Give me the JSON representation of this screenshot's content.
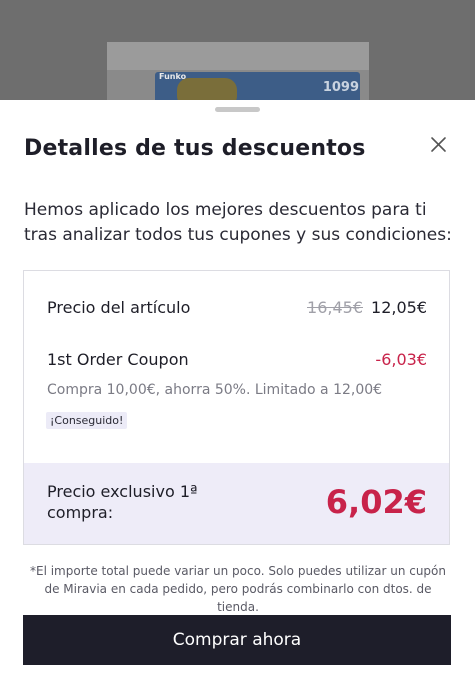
{
  "backdrop": {
    "product_number": "1099",
    "brand": "Funko"
  },
  "sheet": {
    "title": "Detalles de tus descuentos",
    "intro": "Hemos aplicado los mejores descuentos para ti tras analizar todos tus cupones y sus condiciones:",
    "item_price": {
      "label": "Precio del artículo",
      "old_price": "16,45€",
      "new_price": "12,05€"
    },
    "coupon": {
      "name": "1st Order Coupon",
      "amount": "-6,03€",
      "description": "Compra 10,00€, ahorra 50%. Limitado a 12,00€",
      "badge": "¡Conseguido!"
    },
    "exclusive": {
      "label": "Precio exclusivo 1ª compra:",
      "price": "6,02€"
    },
    "note": "*El importe total puede variar un poco. Solo puedes utilizar un cupón de Miravia en cada pedido, pero podrás combinarlo con dtos. de tienda.",
    "buy_label": "Comprar ahora"
  },
  "colors": {
    "accent": "#c8234a",
    "button": "#1e1e2a",
    "highlight_bg": "#eeecf8"
  },
  "icons": {
    "close": "close-icon"
  }
}
